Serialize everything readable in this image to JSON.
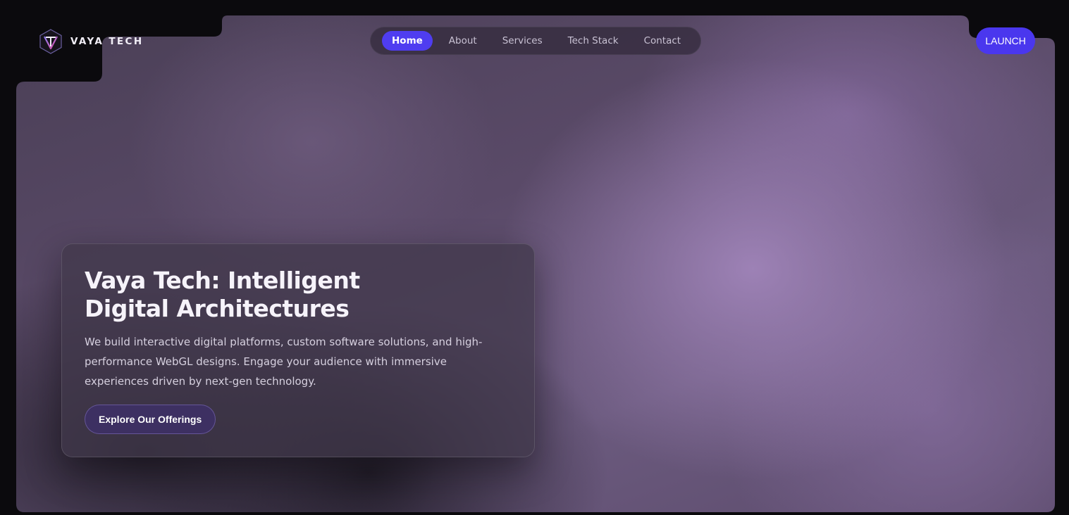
{
  "brand": {
    "name": "VAYA TECH",
    "logo_icon": "hexagon-t-logo-icon",
    "accent_color": "#4f3df0"
  },
  "nav": {
    "items": [
      {
        "label": "Home",
        "active": true
      },
      {
        "label": "About",
        "active": false
      },
      {
        "label": "Services",
        "active": false
      },
      {
        "label": "Tech Stack",
        "active": false
      },
      {
        "label": "Contact",
        "active": false
      }
    ]
  },
  "header": {
    "launch_label": "LAUNCH"
  },
  "hero": {
    "title_line1": "Vaya Tech: Intelligent",
    "title_line2": "Digital Architectures",
    "description": "We build interactive digital platforms, custom software solutions, and high-performance WebGL designs. Engage your audience with immersive experiences driven by next-gen technology.",
    "cta_label": "Explore Our Offerings"
  }
}
